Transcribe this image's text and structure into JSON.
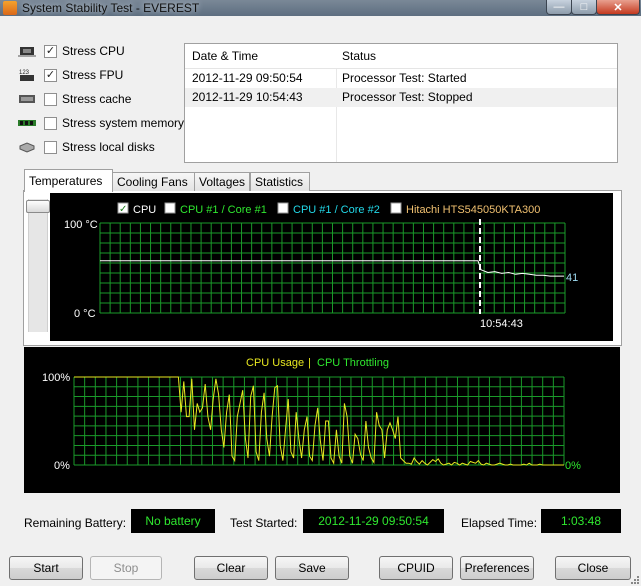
{
  "window": {
    "title": "System Stability Test - EVEREST"
  },
  "options": [
    {
      "label": "Stress CPU",
      "checked": true,
      "icon": "cpu-chip-icon"
    },
    {
      "label": "Stress FPU",
      "checked": true,
      "icon": "fpu-chip-icon"
    },
    {
      "label": "Stress cache",
      "checked": false,
      "icon": "cache-chip-icon"
    },
    {
      "label": "Stress system memory",
      "checked": false,
      "icon": "memory-module-icon"
    },
    {
      "label": "Stress local disks",
      "checked": false,
      "icon": "disk-drive-icon"
    }
  ],
  "log": {
    "headers": {
      "datetime": "Date & Time",
      "status": "Status"
    },
    "rows": [
      {
        "datetime": "2012-11-29 09:50:54",
        "status": "Processor Test: Started"
      },
      {
        "datetime": "2012-11-29 10:54:43",
        "status": "Processor Test: Stopped"
      }
    ]
  },
  "tabs": [
    "Temperatures",
    "Cooling Fans",
    "Voltages",
    "Statistics"
  ],
  "temperature_graph": {
    "legend": [
      {
        "label": "CPU",
        "checked": true,
        "color": "#ffffff"
      },
      {
        "label": "CPU #1 / Core #1",
        "checked": false,
        "color": "#2fe82f"
      },
      {
        "label": "CPU #1 / Core #2",
        "checked": false,
        "color": "#22d8e8"
      },
      {
        "label": "Hitachi HTS545050KTA300",
        "checked": false,
        "color": "#f0c070"
      }
    ],
    "y_max_label": "100 °C",
    "y_min_label": "0 °C",
    "marker_time": "10:54:43",
    "current_value": "41",
    "series": {
      "before": 58,
      "after": [
        48,
        45,
        46,
        44,
        45,
        43,
        44,
        43,
        42,
        42,
        41,
        41,
        41
      ]
    }
  },
  "usage_graph": {
    "title_usage": "CPU Usage",
    "title_sep": "|",
    "title_throttling": "CPU Throttling",
    "y_max_label": "100%",
    "y_min_label": "0%",
    "right_label": "0%",
    "usage_color": "#e8e820",
    "throttle_color": "#2fe82f",
    "values": [
      100,
      100,
      100,
      100,
      100,
      100,
      100,
      100,
      100,
      100,
      100,
      100,
      100,
      100,
      100,
      100,
      100,
      100,
      100,
      100,
      100,
      100,
      100,
      100,
      100,
      100,
      100,
      100,
      100,
      100,
      100,
      100,
      100,
      100,
      100,
      100,
      100,
      100,
      100,
      100,
      60,
      95,
      55,
      55,
      98,
      40,
      70,
      60,
      65,
      92,
      55,
      40,
      75,
      98,
      80,
      40,
      20,
      60,
      80,
      10,
      5,
      55,
      70,
      85,
      30,
      8,
      78,
      90,
      15,
      5,
      60,
      82,
      30,
      10,
      55,
      88,
      90,
      22,
      5,
      40,
      75,
      15,
      8,
      60,
      30,
      8,
      40,
      55,
      10,
      5,
      45,
      65,
      28,
      5,
      50,
      50,
      8,
      2,
      40,
      10,
      2,
      70,
      55,
      10,
      2,
      35,
      30,
      12,
      5,
      50,
      20,
      8,
      3,
      60,
      45,
      40,
      8,
      40,
      48,
      40,
      30,
      55,
      8,
      5,
      2,
      2,
      1,
      8,
      4,
      1,
      5,
      2,
      0,
      3,
      6,
      4,
      7,
      2,
      0,
      1,
      2,
      0,
      3,
      2,
      0,
      2,
      1,
      0,
      4,
      3,
      2,
      5,
      1,
      0,
      2,
      1,
      0,
      0,
      1,
      2,
      1,
      0,
      0,
      1,
      0,
      0,
      0,
      0,
      1,
      0,
      2,
      0,
      0,
      0,
      1,
      0,
      0,
      0,
      0,
      0,
      0,
      0,
      0,
      0
    ]
  },
  "status": {
    "battery_label": "Remaining Battery:",
    "battery_value": "No battery",
    "started_label": "Test Started:",
    "started_value": "2012-11-29 09:50:54",
    "elapsed_label": "Elapsed Time:",
    "elapsed_value": "1:03:48"
  },
  "buttons": {
    "start": "Start",
    "stop": "Stop",
    "clear": "Clear",
    "save": "Save",
    "cpuid": "CPUID",
    "preferences": "Preferences",
    "close": "Close"
  }
}
